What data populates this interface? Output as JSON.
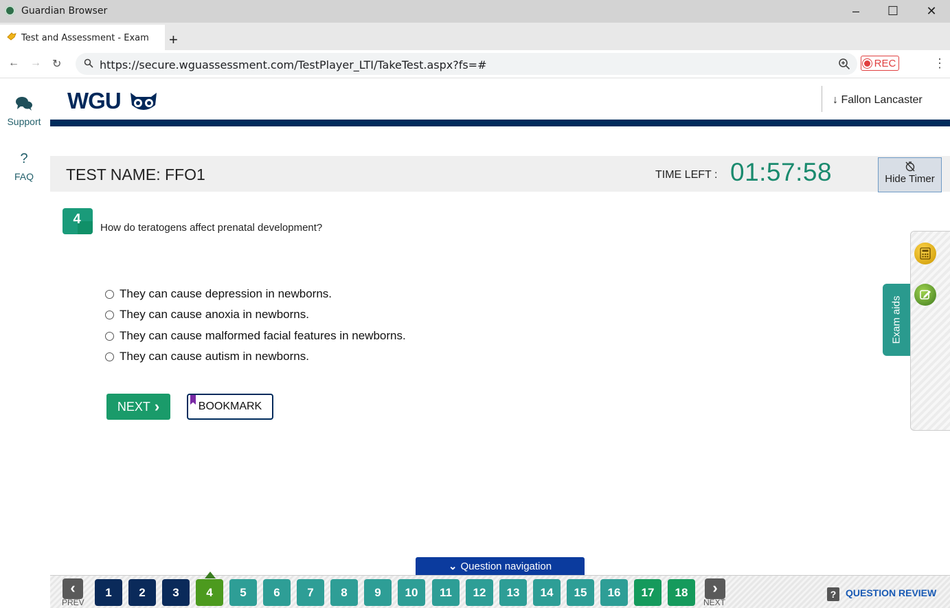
{
  "window": {
    "title": "Guardian Browser",
    "min": "–",
    "max": "☐",
    "close": "✕"
  },
  "tab": {
    "label": "Test and Assessment - Exam",
    "new_tab": "+"
  },
  "nav": {
    "back": "←",
    "forward": "→",
    "reload": "↻",
    "url": "https://secure.wguassessment.com/TestPlayer_LTI/TakeTest.aspx?fs=#",
    "rec": "REC",
    "menu": "⋮"
  },
  "sidebar": {
    "support": "Support",
    "faq_glyph": "?",
    "faq": "FAQ"
  },
  "header": {
    "logo": "WGU",
    "user": "↓ Fallon Lancaster"
  },
  "testbar": {
    "test_name": "TEST NAME:  FFO1",
    "time_label": "TIME LEFT :",
    "timer": "01:57:58",
    "hide_timer": "Hide Timer"
  },
  "question": {
    "number": "4",
    "text": "How do teratogens affect prenatal development?",
    "options": [
      "They can cause depression in newborns.",
      "They can cause anoxia in newborns.",
      "They can cause malformed facial features in newborns.",
      "They can cause autism in newborns."
    ],
    "next_label": "NEXT",
    "next_glyph": "›",
    "bookmark_label": "BOOKMARK"
  },
  "exam_aids": {
    "label": "Exam aids"
  },
  "qnav": {
    "toggle": "Question navigation",
    "toggle_glyph": "⌄",
    "prev_glyph": "‹",
    "prev": "PREV",
    "next_glyph": "›",
    "next": "NEXT",
    "review_icon": "?",
    "review": "QUESTION REVIEW",
    "questions": [
      {
        "n": "1",
        "color": "#0a2a5a"
      },
      {
        "n": "2",
        "color": "#0a2a5a"
      },
      {
        "n": "3",
        "color": "#0a2a5a"
      },
      {
        "n": "4",
        "color": "#4c9a1e"
      },
      {
        "n": "5",
        "color": "#2e9e96"
      },
      {
        "n": "6",
        "color": "#2e9e96"
      },
      {
        "n": "7",
        "color": "#2e9e96"
      },
      {
        "n": "8",
        "color": "#2e9e96"
      },
      {
        "n": "9",
        "color": "#2e9e96"
      },
      {
        "n": "10",
        "color": "#2e9e96"
      },
      {
        "n": "11",
        "color": "#2e9e96"
      },
      {
        "n": "12",
        "color": "#2e9e96"
      },
      {
        "n": "13",
        "color": "#2e9e96"
      },
      {
        "n": "14",
        "color": "#2e9e96"
      },
      {
        "n": "15",
        "color": "#2e9e96"
      },
      {
        "n": "16",
        "color": "#2e9e96"
      },
      {
        "n": "17",
        "color": "#159a5c"
      },
      {
        "n": "18",
        "color": "#159a5c"
      }
    ]
  }
}
